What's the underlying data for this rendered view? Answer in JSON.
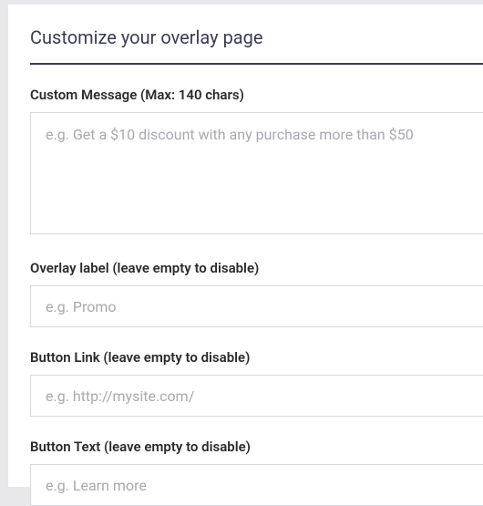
{
  "heading": "Customize your overlay page",
  "fields": {
    "customMessage": {
      "label": "Custom Message (Max: 140 chars)",
      "placeholder": "e.g. Get a $10 discount with any purchase more than $50",
      "value": ""
    },
    "overlayLabel": {
      "label": "Overlay label (leave empty to disable)",
      "placeholder": "e.g. Promo",
      "value": ""
    },
    "buttonLink": {
      "label": "Button Link (leave empty to disable)",
      "placeholder": "e.g. http://mysite.com/",
      "value": ""
    },
    "buttonText": {
      "label": "Button Text (leave empty to disable)",
      "placeholder": "e.g. Learn more",
      "value": ""
    }
  }
}
